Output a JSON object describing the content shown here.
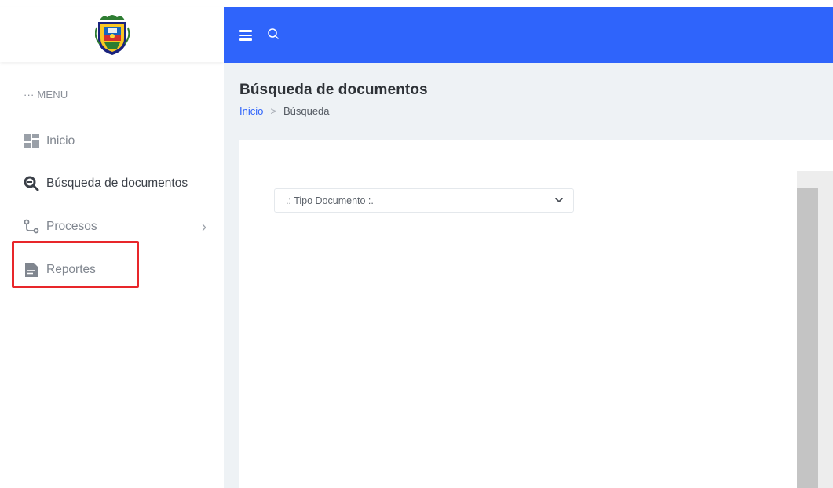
{
  "sidebar": {
    "menu_title": "··· MENU",
    "items": [
      {
        "label": "Inicio",
        "icon": "dashboard-icon"
      },
      {
        "label": "Búsqueda de documentos",
        "icon": "search-icon"
      },
      {
        "label": "Procesos",
        "icon": "process-icon",
        "chevron": "›"
      },
      {
        "label": "Reportes",
        "icon": "report-icon"
      }
    ],
    "highlight_color": "#e8262a"
  },
  "header": {
    "background": "#2f64fb",
    "menu_icon": "hamburger-icon",
    "search_icon": "search-icon"
  },
  "main": {
    "title": "Búsqueda de documentos",
    "breadcrumb": {
      "home": "Inicio",
      "separator": ">",
      "current": "Búsqueda"
    },
    "document_type_select": {
      "selected": ".: Tipo Documento :."
    }
  },
  "colors": {
    "accent": "#2f64fb",
    "content_bg": "#eef2f5"
  }
}
